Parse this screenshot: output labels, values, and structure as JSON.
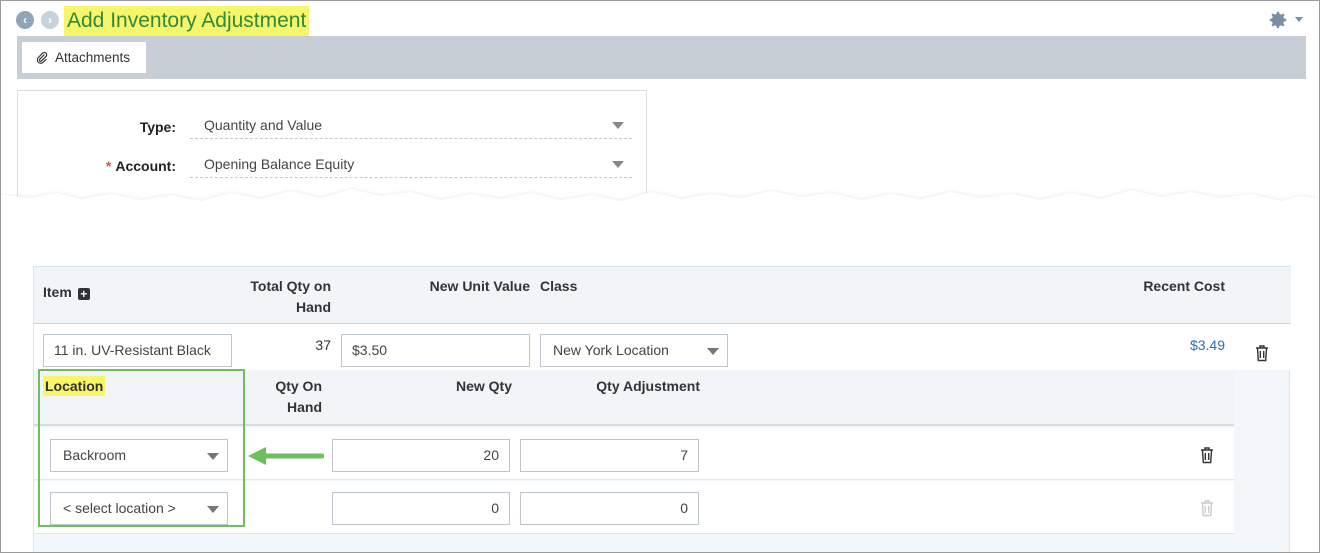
{
  "header": {
    "title": "Add Inventory Adjustment",
    "back_icon": "arrow-left-icon",
    "forward_icon": "arrow-right-icon",
    "settings_icon": "gear-icon"
  },
  "toolbar": {
    "attachments_label": "Attachments",
    "attachments_icon": "paperclip-icon"
  },
  "form": {
    "type_label": "Type:",
    "type_value": "Quantity and Value",
    "account_required": "*",
    "account_label": "Account:",
    "account_value": "Opening Balance Equity"
  },
  "grid": {
    "headers": {
      "item": "Item",
      "total_qty_line1": "Total Qty on",
      "total_qty_line2": "Hand",
      "new_unit_value": "New Unit Value",
      "class": "Class",
      "recent_cost": "Recent Cost"
    },
    "row": {
      "item": "11 in. UV-Resistant Black",
      "total_qty": "37",
      "new_unit_value": "$3.50",
      "class": "New York Location",
      "recent_cost": "$3.49"
    },
    "sub_headers": {
      "location": "Location",
      "qty_on_hand_line1": "Qty On",
      "qty_on_hand_line2": "Hand",
      "new_qty": "New Qty",
      "qty_adjustment": "Qty Adjustment"
    },
    "sub_rows": [
      {
        "location": "Backroom",
        "new_qty": "20",
        "qty_adjustment": "7"
      },
      {
        "location": "< select location >",
        "new_qty": "0",
        "qty_adjustment": "0"
      }
    ]
  },
  "colors": {
    "highlight": "#f7f56a",
    "title_green": "#2e8b3e",
    "annotation_green": "#6fbf5e",
    "link_blue": "#2f6fb0"
  }
}
